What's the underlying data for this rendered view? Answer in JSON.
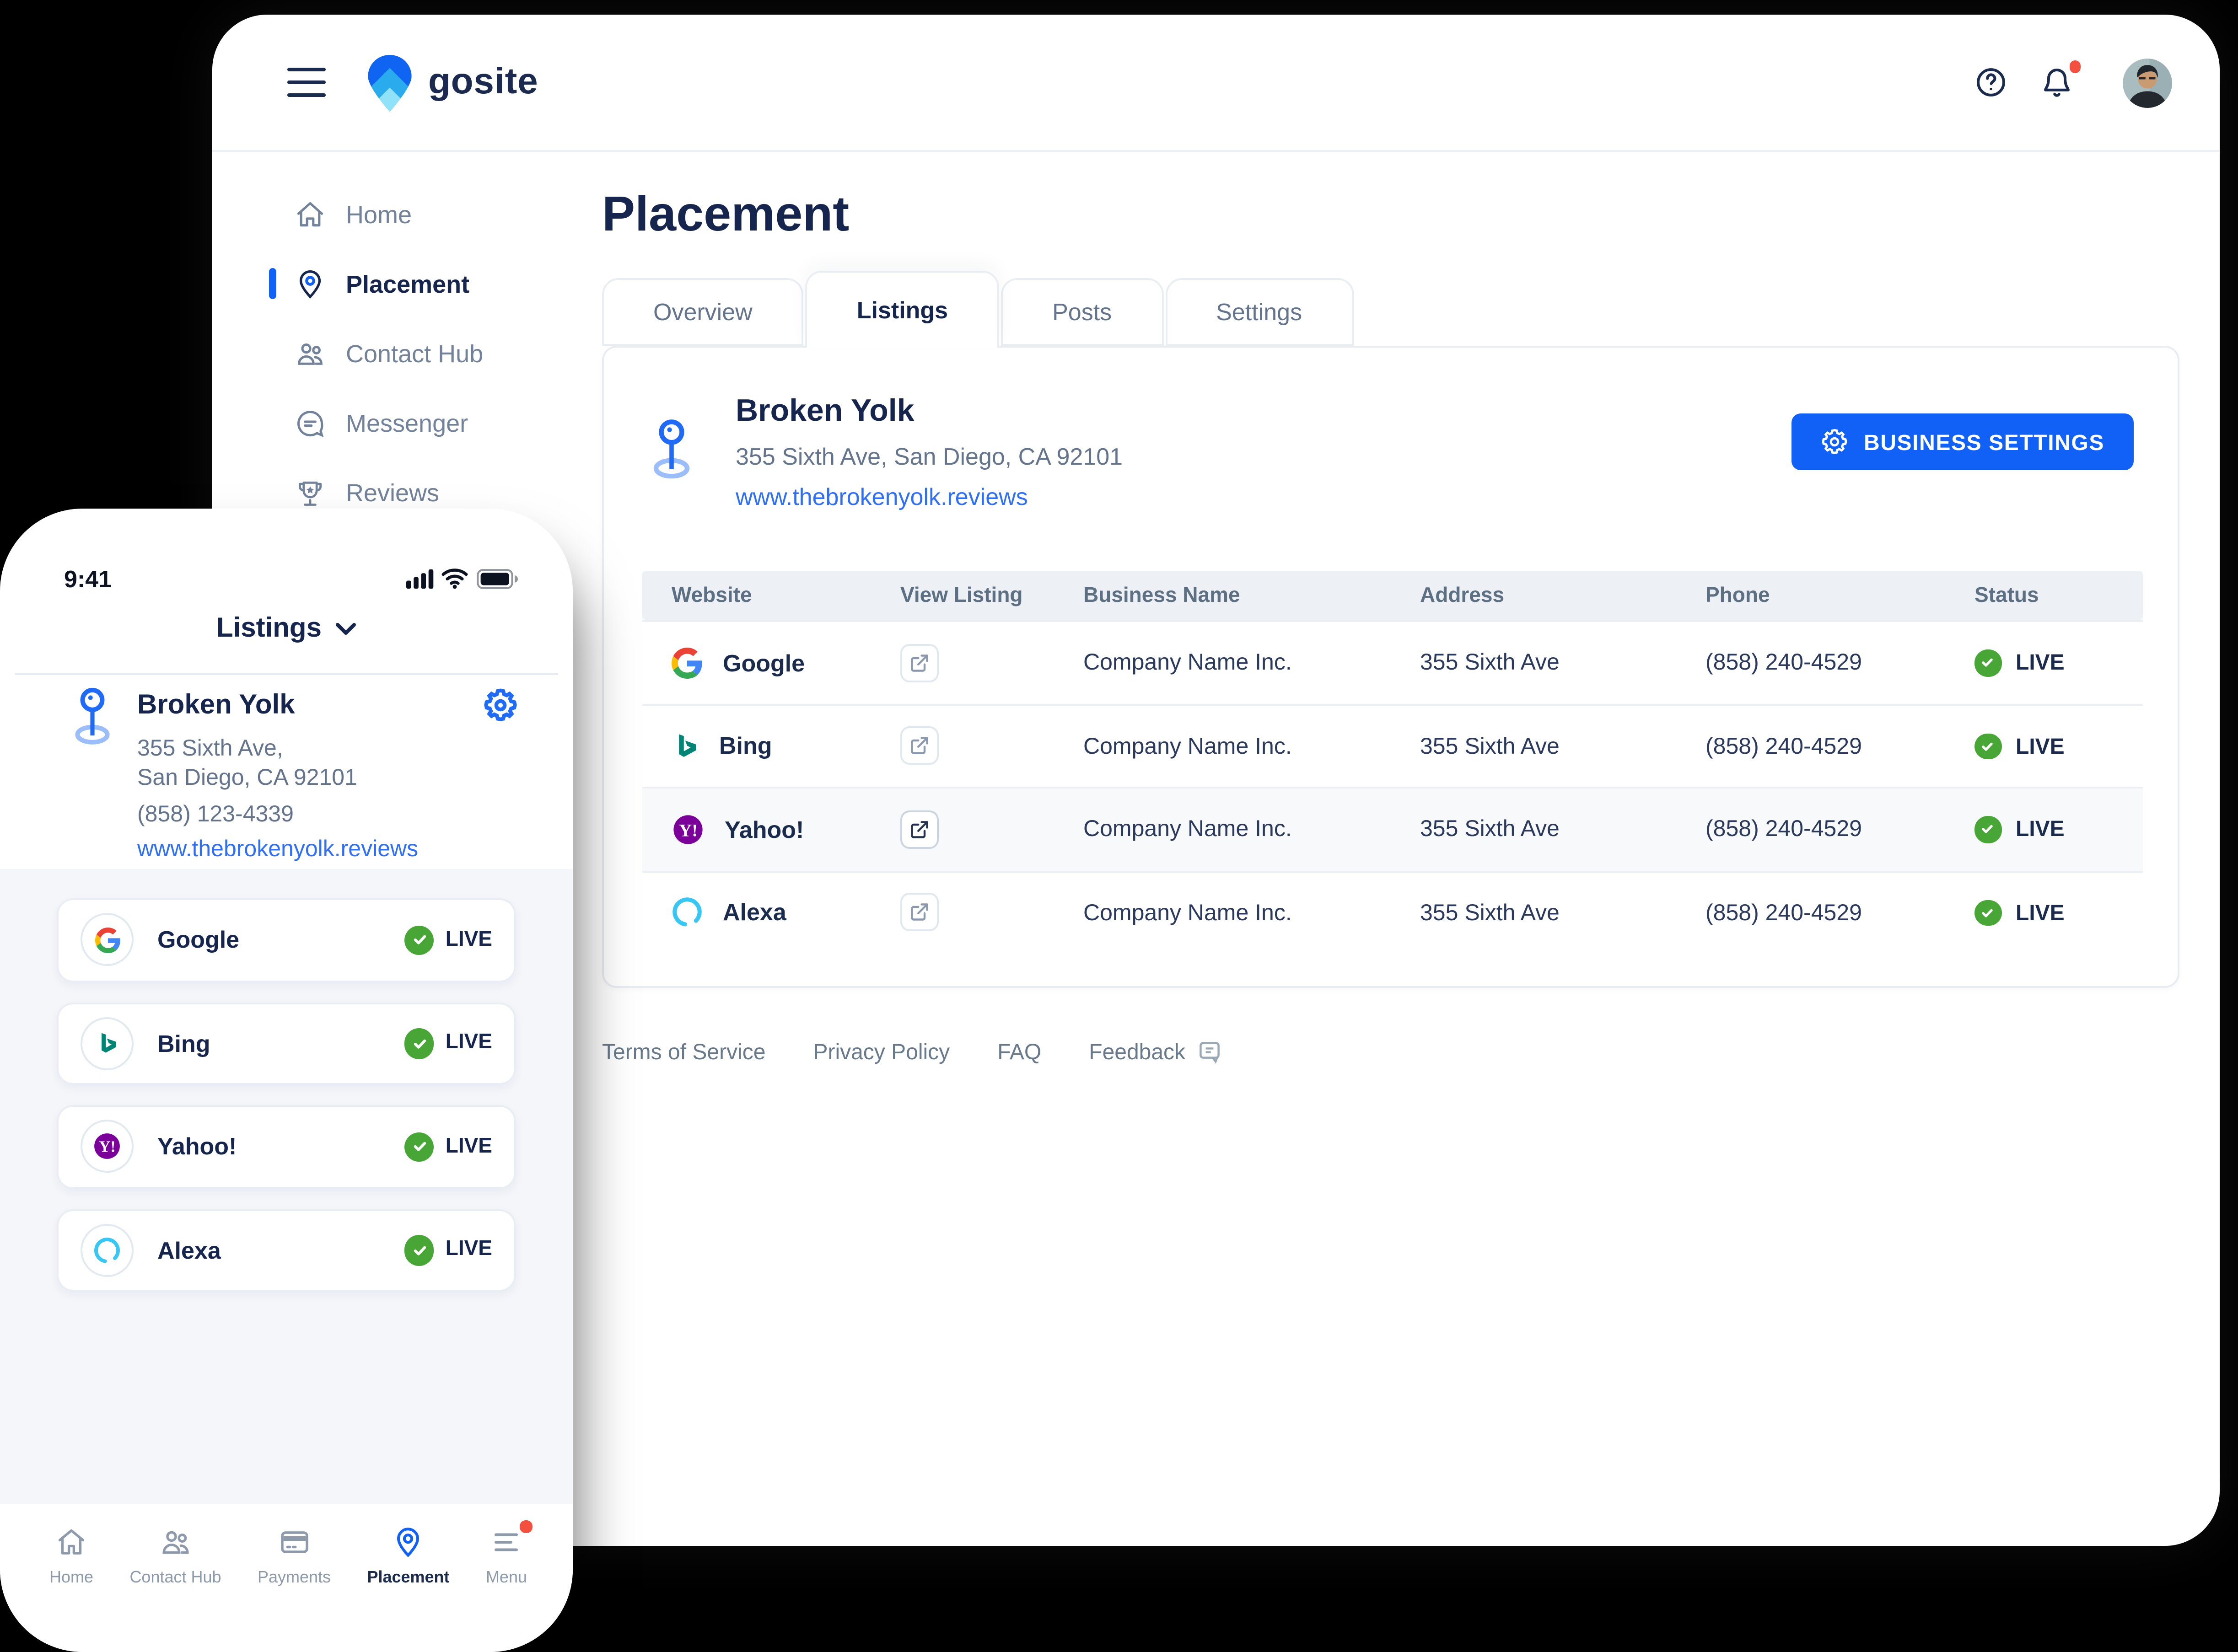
{
  "brand": {
    "name": "gosite"
  },
  "colors": {
    "accent": "#1161f6",
    "navy": "#16254e",
    "green": "#47a636",
    "alert_red": "#f4503f"
  },
  "desktop": {
    "sidebar": {
      "items": [
        {
          "label": "Home"
        },
        {
          "label": "Placement"
        },
        {
          "label": "Contact Hub"
        },
        {
          "label": "Messenger"
        },
        {
          "label": "Reviews"
        }
      ]
    },
    "page_title": "Placement",
    "tabs": [
      {
        "label": "Overview"
      },
      {
        "label": "Listings"
      },
      {
        "label": "Posts"
      },
      {
        "label": "Settings"
      }
    ],
    "business": {
      "name": "Broken Yolk",
      "address": "355 Sixth Ave, San Diego, CA 92101",
      "website": "www.thebrokenyolk.reviews",
      "settings_button": "BUSINESS SETTINGS"
    },
    "table": {
      "columns": [
        "Website",
        "View Listing",
        "Business Name",
        "Address",
        "Phone",
        "Status"
      ],
      "rows": [
        {
          "site": "Google",
          "business": "Company Name Inc.",
          "address": "355 Sixth Ave",
          "phone": "(858) 240-4529",
          "status": "LIVE"
        },
        {
          "site": "Bing",
          "business": "Company Name Inc.",
          "address": "355 Sixth Ave",
          "phone": "(858) 240-4529",
          "status": "LIVE"
        },
        {
          "site": "Yahoo!",
          "business": "Company Name Inc.",
          "address": "355 Sixth Ave",
          "phone": "(858) 240-4529",
          "status": "LIVE"
        },
        {
          "site": "Alexa",
          "business": "Company Name Inc.",
          "address": "355 Sixth Ave",
          "phone": "(858) 240-4529",
          "status": "LIVE"
        }
      ]
    },
    "footer_links": [
      {
        "label": "Terms of Service"
      },
      {
        "label": "Privacy Policy"
      },
      {
        "label": "FAQ"
      },
      {
        "label": "Feedback"
      }
    ]
  },
  "phone": {
    "status_bar": {
      "time": "9:41"
    },
    "nav_title": "Listings",
    "business": {
      "name": "Broken Yolk",
      "address_line1": "355 Sixth Ave,",
      "address_line2": "San Diego, CA 92101",
      "phone": "(858) 123-4339",
      "website": "www.thebrokenyolk.reviews"
    },
    "listings": [
      {
        "name": "Google",
        "status": "LIVE"
      },
      {
        "name": "Bing",
        "status": "LIVE"
      },
      {
        "name": "Yahoo!",
        "status": "LIVE"
      },
      {
        "name": "Alexa",
        "status": "LIVE"
      }
    ],
    "bottom_nav": [
      {
        "label": "Home"
      },
      {
        "label": "Contact Hub"
      },
      {
        "label": "Payments"
      },
      {
        "label": "Placement"
      },
      {
        "label": "Menu"
      }
    ]
  }
}
